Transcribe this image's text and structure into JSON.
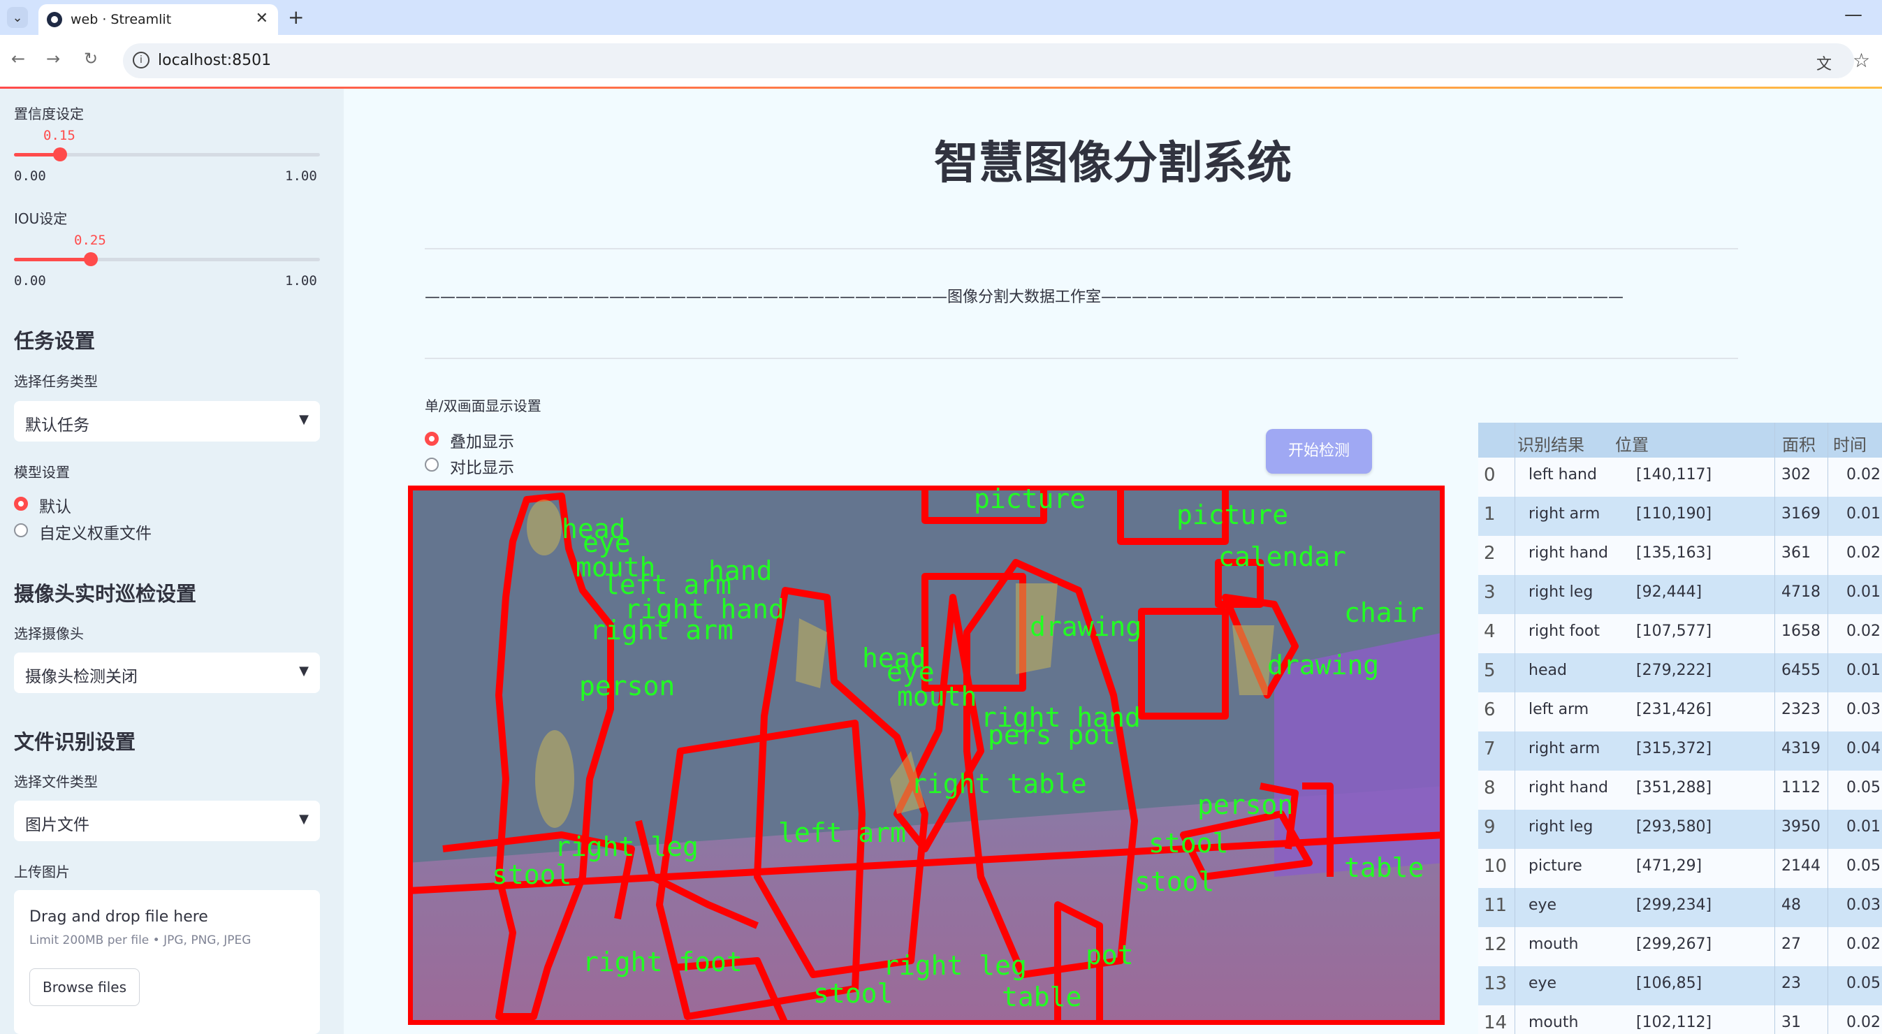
{
  "browser": {
    "tab_title": "web · Streamlit",
    "url": "localhost:8501",
    "new_tab_symbol": "+",
    "close_symbol": "✕",
    "minimize_symbol": "—"
  },
  "sidebar": {
    "confidence_label": "置信度设定",
    "confidence_value": "0.15",
    "confidence_min": "0.00",
    "confidence_max": "1.00",
    "confidence_fraction": 0.15,
    "iou_label": "IOU设定",
    "iou_value": "0.25",
    "iou_min": "0.00",
    "iou_max": "1.00",
    "iou_fraction": 0.25,
    "task_heading": "任务设置",
    "task_type_label": "选择任务类型",
    "task_type_value": "默认任务",
    "model_label": "模型设置",
    "model_options": [
      "默认",
      "自定义权重文件"
    ],
    "camera_heading": "摄像头实时巡检设置",
    "camera_label": "选择摄像头",
    "camera_value": "摄像头检测关闭",
    "file_heading": "文件识别设置",
    "file_type_label": "选择文件类型",
    "file_type_value": "图片文件",
    "upload_label": "上传图片",
    "upload_title": "Drag and drop file here",
    "upload_limit": "Limit 200MB per file • JPG, PNG, JPEG",
    "browse_label": "Browse files"
  },
  "main": {
    "title": "智慧图像分割系统",
    "studio_line": "——————————————————————————————————图像分割大数据工作室——————————————————————————————————",
    "display_setting_label": "单/双画面显示设置",
    "display_options": [
      "叠加显示",
      "对比显示"
    ],
    "start_button": "开始检测"
  },
  "image_labels": [
    "head",
    "eye",
    "mouth",
    "hand",
    "left arm",
    "right hand",
    "right arm",
    "person",
    "picture",
    "picture",
    "calendar",
    "drawing",
    "chair",
    "drawing",
    "head",
    "eye",
    "mouth",
    "right hand",
    "pers pot",
    "right table",
    "person",
    "left arm",
    "stool",
    "stool",
    "right leg",
    "stool",
    "right foot",
    "right leg",
    "pot",
    "stool",
    "table",
    "table"
  ],
  "table": {
    "headers": [
      "识别结果",
      "位置",
      "面积",
      "时间"
    ],
    "rows": [
      {
        "idx": "0",
        "name": "left hand",
        "pos": "[140,117]",
        "area": "302",
        "time": "0.02"
      },
      {
        "idx": "1",
        "name": "right arm",
        "pos": "[110,190]",
        "area": "3169",
        "time": "0.01"
      },
      {
        "idx": "2",
        "name": "right hand",
        "pos": "[135,163]",
        "area": "361",
        "time": "0.02"
      },
      {
        "idx": "3",
        "name": "right leg",
        "pos": "[92,444]",
        "area": "4718",
        "time": "0.01"
      },
      {
        "idx": "4",
        "name": "right foot",
        "pos": "[107,577]",
        "area": "1658",
        "time": "0.02"
      },
      {
        "idx": "5",
        "name": "head",
        "pos": "[279,222]",
        "area": "6455",
        "time": "0.01"
      },
      {
        "idx": "6",
        "name": "left arm",
        "pos": "[231,426]",
        "area": "2323",
        "time": "0.03"
      },
      {
        "idx": "7",
        "name": "right arm",
        "pos": "[315,372]",
        "area": "4319",
        "time": "0.04"
      },
      {
        "idx": "8",
        "name": "right hand",
        "pos": "[351,288]",
        "area": "1112",
        "time": "0.05"
      },
      {
        "idx": "9",
        "name": "right leg",
        "pos": "[293,580]",
        "area": "3950",
        "time": "0.01"
      },
      {
        "idx": "10",
        "name": "picture",
        "pos": "[471,29]",
        "area": "2144",
        "time": "0.05"
      },
      {
        "idx": "11",
        "name": "eye",
        "pos": "[299,234]",
        "area": "48",
        "time": "0.03"
      },
      {
        "idx": "12",
        "name": "mouth",
        "pos": "[299,267]",
        "area": "27",
        "time": "0.02"
      },
      {
        "idx": "13",
        "name": "eye",
        "pos": "[106,85]",
        "area": "23",
        "time": "0.05"
      },
      {
        "idx": "14",
        "name": "mouth",
        "pos": "[102,112]",
        "area": "31",
        "time": "0.02"
      }
    ]
  },
  "colors": {
    "accent": "#ff4b4b",
    "mask_outline": "#ff0000",
    "label_text": "#22ff22",
    "button": "#9fa8f3"
  }
}
